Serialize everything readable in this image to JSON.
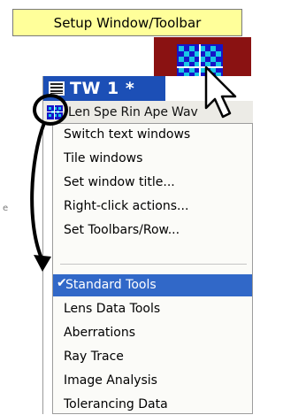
{
  "callout": {
    "text": "Setup Window/Toolbar"
  },
  "window": {
    "title": "TW 1 *",
    "menubar": [
      "Len",
      "Spe",
      "Rin",
      "Ape",
      "Wav"
    ]
  },
  "menu": {
    "group1": [
      "Switch text windows",
      "Tile windows",
      "Set window title...",
      "Right-click actions...",
      "Set Toolbars/Row..."
    ],
    "selected": "Standard Tools",
    "group2": [
      "Lens Data Tools",
      "Aberrations",
      "Ray Trace",
      "Image Analysis",
      "Tolerancing Data"
    ]
  },
  "colors": {
    "callout_bg": "#ffff9a",
    "icon_panel_bg": "#8a1212",
    "titlebar_bg": "#1c4fb6",
    "selection_bg": "#3168c8"
  },
  "icons": [
    "toolbar-grid-icon",
    "mouse-cursor-icon",
    "window-lines-icon",
    "checkmark-icon"
  ]
}
